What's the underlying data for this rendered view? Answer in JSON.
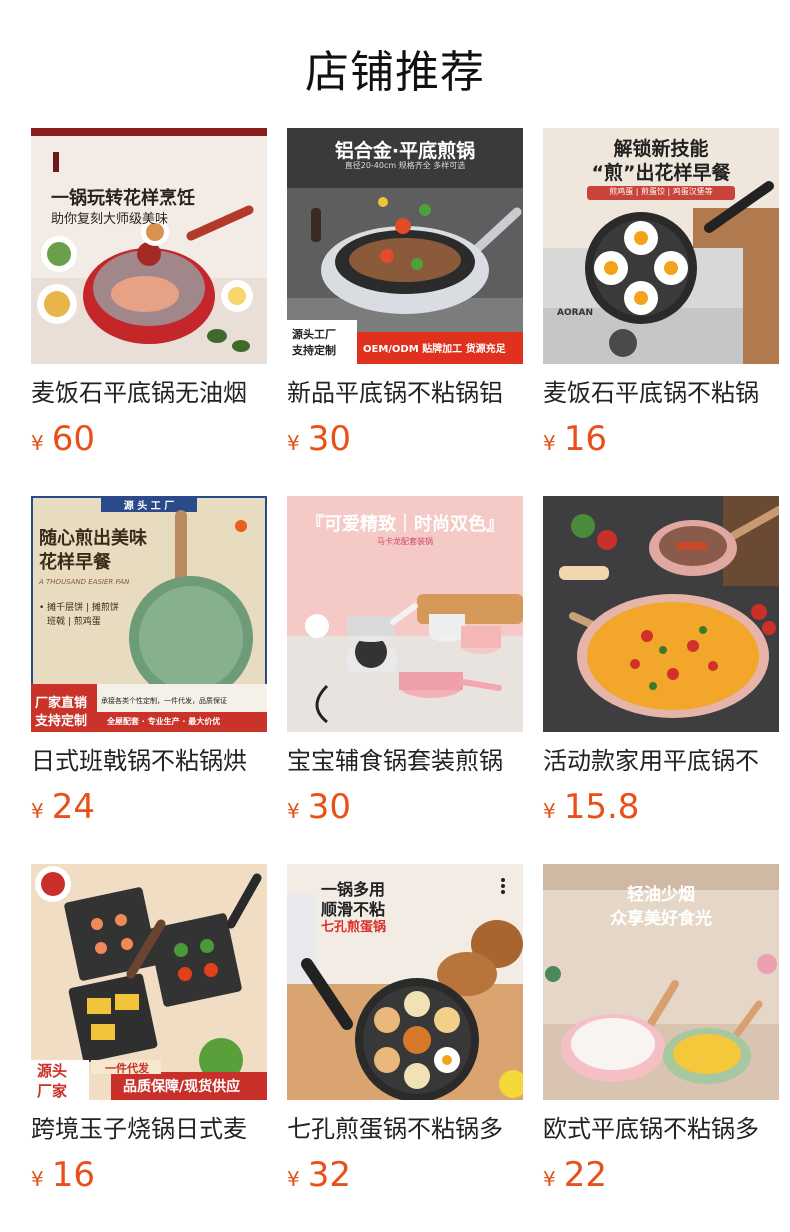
{
  "page": {
    "title": "店铺推荐"
  },
  "colors": {
    "price": "#e8501a",
    "title": "#111111",
    "name": "#222222"
  },
  "products": [
    {
      "name": "麦饭石平底锅无油烟",
      "currency": "¥",
      "price": "60",
      "image": {
        "icon": "red-frying-pan-image",
        "lines": [
          "一锅玩转花样烹饪",
          "助你复刻大师级美味"
        ]
      }
    },
    {
      "name": "新品平底锅不粘锅铝",
      "currency": "¥",
      "price": "30",
      "image": {
        "icon": "silver-wok-image",
        "lines": [
          "铝合金·平底煎锅",
          "直径20-40cm 规格齐全 多样可选",
          "源头工厂",
          "支持定制",
          "OEM/ODM 贴牌加工 货源充足"
        ]
      }
    },
    {
      "name": "麦饭石平底锅不粘锅",
      "currency": "¥",
      "price": "16",
      "image": {
        "icon": "four-egg-pan-image",
        "lines": [
          "解锁新技能",
          "“煎”出花样早餐",
          "煎鸡蛋 | 煎蛋饺 | 鸡蛋汉堡等",
          "AORAN"
        ]
      }
    },
    {
      "name": "日式班戟锅不粘锅烘",
      "currency": "¥",
      "price": "24",
      "image": {
        "icon": "green-crepe-pan-image",
        "lines": [
          "源 头 工 厂",
          "随心煎出美味",
          "花样早餐",
          "A THOUSAND EASIER PAN",
          "• 摊千层饼 | 摊煎饼",
          "班戟 | 煎鸡蛋",
          "厂家直销",
          "支持定制",
          "承接各类个性定制，一件代发，品质保证",
          "全屋配套 · 专业生产 · 最大价优"
        ]
      }
    },
    {
      "name": "宝宝辅食锅套装煎锅",
      "currency": "¥",
      "price": "30",
      "image": {
        "icon": "pink-saucepan-set-image",
        "lines": [
          "『可爱精致｜时尚双色』",
          "马卡龙配套装锅"
        ]
      }
    },
    {
      "name": "活动款家用平底锅不",
      "currency": "¥",
      "price": "15.8",
      "image": {
        "icon": "pizza-pan-image",
        "lines": []
      }
    },
    {
      "name": "跨境玉子烧锅日式麦",
      "currency": "¥",
      "price": "16",
      "image": {
        "icon": "tamagoyaki-pan-image",
        "lines": [
          "源头",
          "厂家",
          "一件代发",
          "品质保障/现货供应"
        ]
      }
    },
    {
      "name": "七孔煎蛋锅不粘锅多",
      "currency": "¥",
      "price": "32",
      "image": {
        "icon": "seven-hole-egg-pan-image",
        "lines": [
          "一锅多用",
          "顺滑不粘",
          "七孔煎蛋锅"
        ]
      }
    },
    {
      "name": "欧式平底锅不粘锅多",
      "currency": "¥",
      "price": "22",
      "image": {
        "icon": "pastel-pans-image",
        "lines": [
          "轻油少烟",
          "众享美好食光"
        ]
      }
    }
  ]
}
